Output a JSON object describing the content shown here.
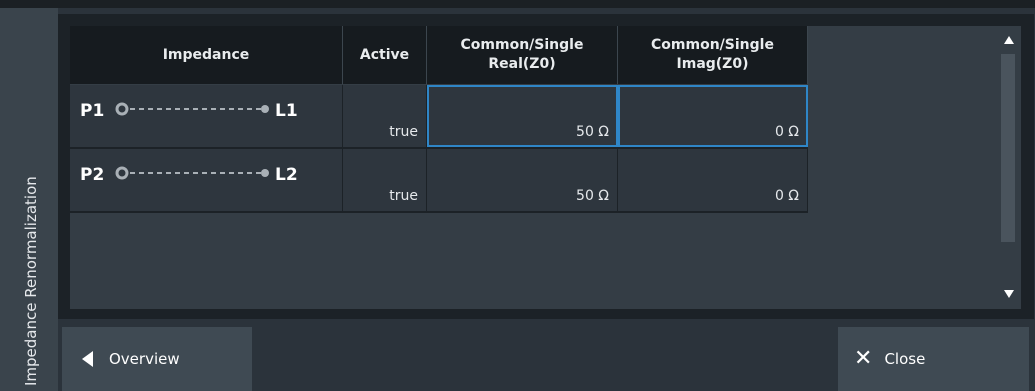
{
  "sidebar": {
    "title": "Impedance Renormalization"
  },
  "table": {
    "headers": [
      "Impedance",
      "Active",
      "Common/Single\nReal(Z0)",
      "Common/Single\nImag(Z0)"
    ],
    "rows": [
      {
        "port": "P1",
        "line": "L1",
        "active": "true",
        "real": "50 Ω",
        "imag": "0 Ω"
      },
      {
        "port": "P2",
        "line": "L2",
        "active": "true",
        "real": "50 Ω",
        "imag": "0 Ω"
      }
    ]
  },
  "buttons": {
    "overview": "Overview",
    "close": "Close"
  },
  "colors": {
    "selection": "#2f86c7",
    "background": "#2b333b",
    "header": "#161b1f"
  },
  "icons": {
    "overview": "triangle-left-icon",
    "close": "close-x-icon",
    "scroll_up": "scroll-up-arrow-icon",
    "scroll_down": "scroll-down-arrow-icon"
  }
}
